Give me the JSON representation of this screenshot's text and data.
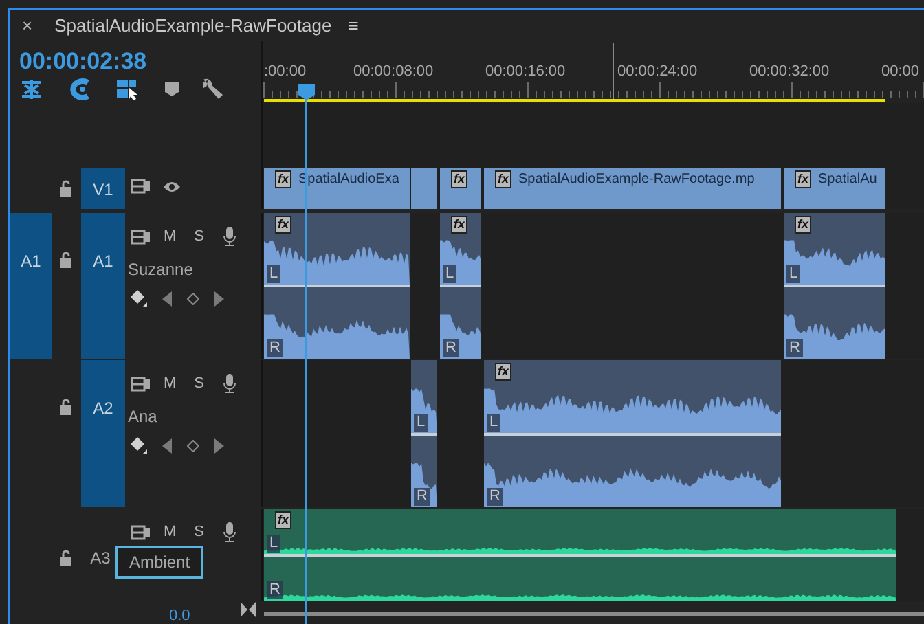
{
  "panel": {
    "close": "×",
    "title": "SpatialAudioExample-RawFootage",
    "menu": "≡"
  },
  "timecode": "00:00:02:38",
  "tools": [
    {
      "kind": "snap",
      "on": true
    },
    {
      "kind": "linked",
      "on": true
    },
    {
      "kind": "select",
      "on": true
    },
    {
      "kind": "marker",
      "on": false
    },
    {
      "kind": "wrench",
      "on": false
    }
  ],
  "ruler": {
    "labels": [
      ":00:00",
      "00:00:08:00",
      "00:00:16:00",
      "00:00:24:00",
      "00:00:32:00",
      "00:00"
    ]
  },
  "tracks": [
    {
      "kind": "video",
      "target": "V1",
      "selected": true,
      "clips": [
        {
          "kind": "video",
          "name": "SpatialAudioExa",
          "fx": "fx"
        },
        {
          "kind": "video"
        },
        {
          "kind": "video",
          "fx": "fx"
        },
        {
          "kind": "video",
          "name": "SpatialAudioExample-RawFootage.mp",
          "fx": "fx"
        },
        {
          "kind": "video",
          "name": "SpatialAu",
          "fx": "fx"
        }
      ]
    },
    {
      "kind": "audio",
      "source": "A1",
      "target": "A1",
      "selected": true,
      "mute": "M",
      "solo": "S",
      "name": "Suzanne",
      "editing": false,
      "expanded": true,
      "clips": [
        {
          "fx": "fx",
          "color": "#78a0d8",
          "channels": [
            "L",
            "R"
          ]
        },
        {
          "fx": "fx",
          "color": "#78a0d8",
          "channels": [
            "L",
            "R"
          ]
        },
        {
          "fx": "fx",
          "color": "#78a0d8",
          "channels": [
            "L",
            "R"
          ]
        }
      ]
    },
    {
      "kind": "audio",
      "target": "A2",
      "selected": true,
      "mute": "M",
      "solo": "S",
      "name": "Ana",
      "editing": false,
      "expanded": true,
      "clips": [
        {
          "color": "#78a0d8",
          "channels": [
            "L",
            "R"
          ]
        },
        {
          "fx": "fx",
          "color": "#78a0d8",
          "channels": [
            "L",
            "R"
          ]
        }
      ]
    },
    {
      "kind": "audio",
      "target": "A3",
      "selected": false,
      "mute": "M",
      "solo": "S",
      "name": "Ambient",
      "editing": true,
      "expanded": false,
      "clips": [
        {
          "fx": "fx",
          "color": "#2ed79b",
          "channels": [
            "L",
            "R"
          ]
        }
      ]
    }
  ],
  "volume": "0.0"
}
